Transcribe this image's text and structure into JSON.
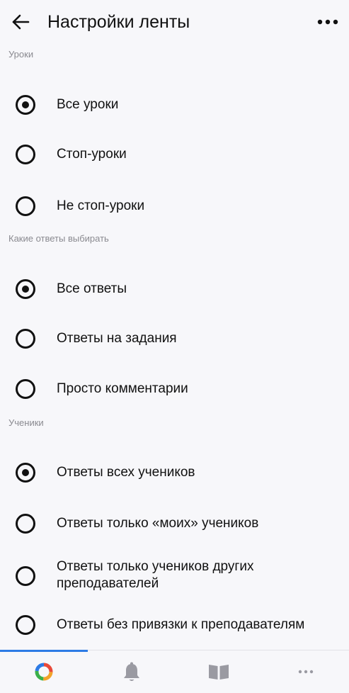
{
  "header": {
    "title": "Настройки ленты",
    "back_icon": "arrow-left-icon",
    "more_icon": "more-horizontal-icon"
  },
  "sections": [
    {
      "label": "Уроки",
      "options": [
        {
          "label": "Все уроки",
          "selected": true
        },
        {
          "label": "Стоп-уроки",
          "selected": false
        },
        {
          "label": "Не стоп-уроки",
          "selected": false
        }
      ]
    },
    {
      "label": "Какие ответы выбирать",
      "options": [
        {
          "label": "Все ответы",
          "selected": true
        },
        {
          "label": "Ответы на задания",
          "selected": false
        },
        {
          "label": "Просто комментарии",
          "selected": false
        }
      ]
    },
    {
      "label": "Ученики",
      "options": [
        {
          "label": "Ответы всех учеников",
          "selected": true
        },
        {
          "label": "Ответы только «моих» учеников",
          "selected": false
        },
        {
          "label": "Ответы только учеников других преподавателей",
          "selected": false
        },
        {
          "label": "Ответы без привязки к преподавателям",
          "selected": false
        }
      ]
    }
  ],
  "tabbar": {
    "active_index": 0,
    "tabs": [
      {
        "icon": "feed-ring-icon"
      },
      {
        "icon": "bell-icon"
      },
      {
        "icon": "book-icon"
      },
      {
        "icon": "more-dots-icon"
      }
    ]
  },
  "colors": {
    "background": "#f7f7fa",
    "text": "#111111",
    "section_label": "#8a8a90",
    "accent": "#2d7be5"
  }
}
